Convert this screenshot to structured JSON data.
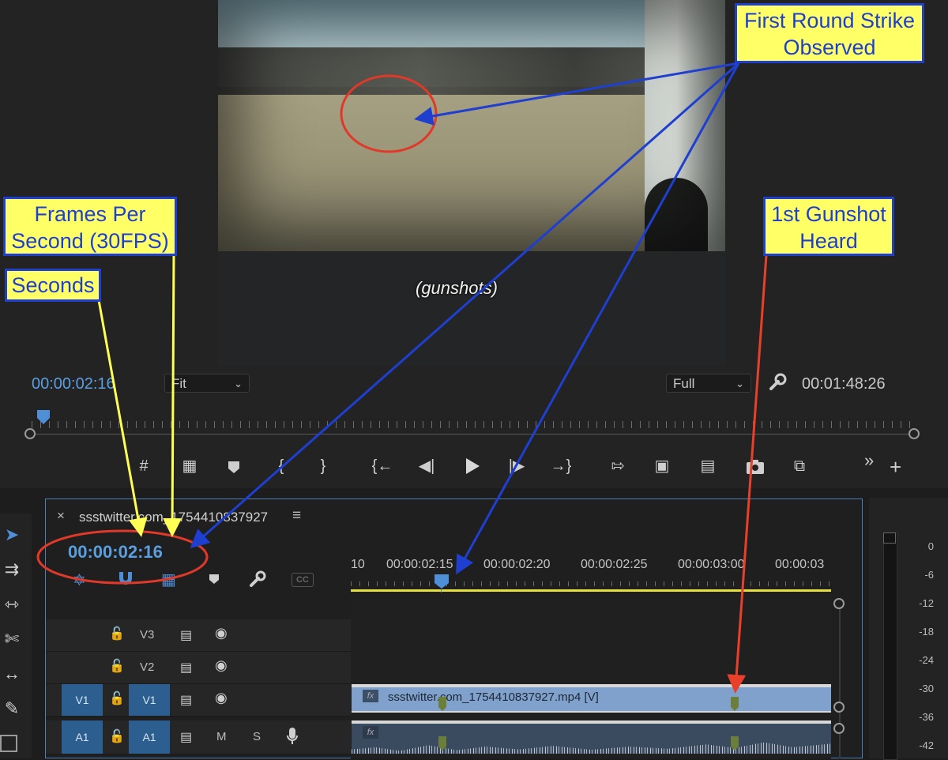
{
  "program_monitor": {
    "caption": "(gunshots)",
    "current_timecode": "00:00:02:16",
    "zoom_select": "Fit",
    "resolution_select": "Full",
    "duration_timecode": "00:01:48:26",
    "playhead_fraction": 0.013
  },
  "transport": {
    "buttons": [
      "marker-grid",
      "add-marker",
      "marker",
      "mark-in",
      "mark-out",
      "go-to-in",
      "step-back",
      "play",
      "step-forward",
      "go-to-out",
      "lift",
      "extract",
      "insert",
      "camera",
      "compare"
    ],
    "more": "»",
    "add": "+"
  },
  "timeline": {
    "close": "×",
    "sequence_name": "ssstwitter.com_1754410837927",
    "menu": "≡",
    "timecode": "00:00:02:16",
    "toolbar_cc": "CC",
    "ruler_labels": [
      "10",
      "00:00:02:15",
      "00:00:02:20",
      "00:00:02:25",
      "00:00:03:00",
      "00:00:03"
    ],
    "tracks": [
      {
        "target": "",
        "name": "V3"
      },
      {
        "target": "",
        "name": "V2"
      },
      {
        "target": "V1",
        "name": "V1"
      },
      {
        "target": "A1",
        "name": "A1",
        "m": "M",
        "s": "S"
      }
    ],
    "video_clip_name": "ssstwitter.com_1754410837927.mp4 [V]",
    "fx": "fx"
  },
  "audio_meter": {
    "db_labels": [
      "0",
      "-6",
      "-12",
      "-18",
      "-24",
      "-30",
      "-36",
      "-42"
    ]
  },
  "annotations": {
    "first_round": [
      "First Round Strike",
      "Observed"
    ],
    "frames_per_second": [
      "Frames Per",
      "Second (30FPS)"
    ],
    "seconds": "Seconds",
    "gunshot": [
      "1st Gunshot",
      "Heard"
    ]
  },
  "colors": {
    "annotation_fill": "#ffff66",
    "annotation_border": "#1e3fd0",
    "arrow_blue": "#1e3fd0",
    "arrow_yellow": "#ffff55",
    "arrow_red": "#e8402a",
    "timecode_blue": "#5b9fe0"
  }
}
